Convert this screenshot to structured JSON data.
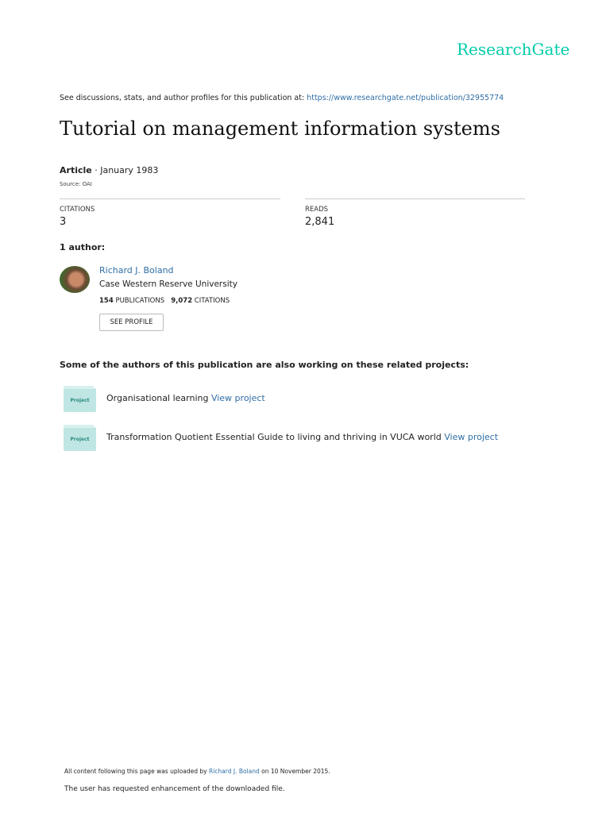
{
  "logo": "ResearchGate",
  "header": {
    "disclaimer": "See discussions, stats, and author profiles for this publication at: ",
    "url": "https://www.researchgate.net/publication/32955774"
  },
  "title": "Tutorial on management information systems",
  "meta": {
    "type": "Article",
    "date": " · January 1983",
    "source": "Source: OAI"
  },
  "stats": {
    "citations_label": "CITATIONS",
    "citations": "3",
    "reads_label": "READS",
    "reads": "2,841"
  },
  "authors_heading": "1 author:",
  "author": {
    "name": "Richard J. Boland",
    "affiliation": "Case Western Reserve University",
    "publications": "154",
    "publications_label": " PUBLICATIONS",
    "citations": "9,072",
    "citations_label": " CITATIONS",
    "button": "SEE PROFILE"
  },
  "projects_heading": "Some of the authors of this publication are also working on these related projects:",
  "projects": [
    {
      "badge": "Project",
      "title": "Organisational learning ",
      "link": "View project"
    },
    {
      "badge": "Project",
      "title": "Transformation Quotient Essential Guide to living and thriving in VUCA world ",
      "link": "View project"
    }
  ],
  "footer": {
    "prefix": "All content following this page was uploaded by ",
    "uploader": "Richard J. Boland",
    "suffix": " on 10 November 2015.",
    "note": "The user has requested enhancement of the downloaded file."
  }
}
